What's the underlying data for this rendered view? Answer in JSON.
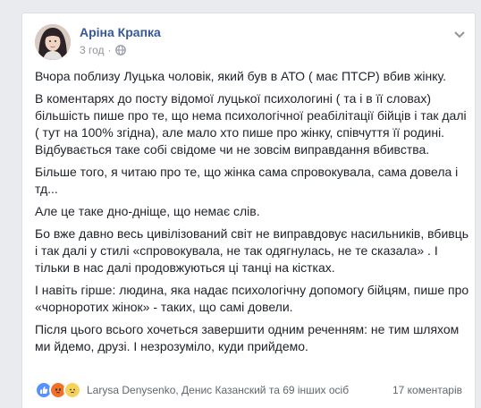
{
  "post": {
    "author": "Аріна Крапка",
    "time": "3 год",
    "separator": "·",
    "icons": {
      "privacy": "globe-icon",
      "menu": "chevron-down-icon"
    },
    "paragraphs": [
      "Вчора поблизу Луцька чоловік, який був в АТО ( має ПТСР) вбив жінку.",
      "В коментарях до посту відомої луцької психологині ( та і в її словах) більшість пише про те, що нема психологічної реабілітації бійців і так далі ( тут на 100% згідна), але мало хто пише про жінку, співчуття її родині. Відбувається таке собі свідоме чи не зовсім виправдання вбивства.",
      "Більше того, я читаю про те, що жінка сама спровокувала, сама довела і тд...",
      "Але це таке дно-дніще, що немає слів.",
      "Бо вже давно весь цивілізований світ не виправдовує насильників, вбивць і так далі у стилі «спровокувала, не так одягнулась, не те сказала» . І тільки в нас далі продовжуються ці танці на кістках.",
      "І навіть гірше: людина, яка надає психологічну допомогу бійцям, пише про «чорноротих жінок» - таких, що самі довели.",
      "Після цього всього хочеться завершити одним реченням: не тим шляхом ми йдемо, друзі. І незрозуміло, куди прийдемо."
    ]
  },
  "footer": {
    "reactions": [
      "like-icon",
      "angry-icon",
      "sad-icon"
    ],
    "reactors": "Larysa Denysenko, Денис Казанский та 69 інших осіб",
    "comments": "17 коментарів"
  },
  "colors": {
    "author_link": "#365899",
    "text": "#1d2129",
    "meta": "#90949c",
    "like": "#5890ff",
    "angry": "#f0722a",
    "sad": "#f7d25b"
  }
}
